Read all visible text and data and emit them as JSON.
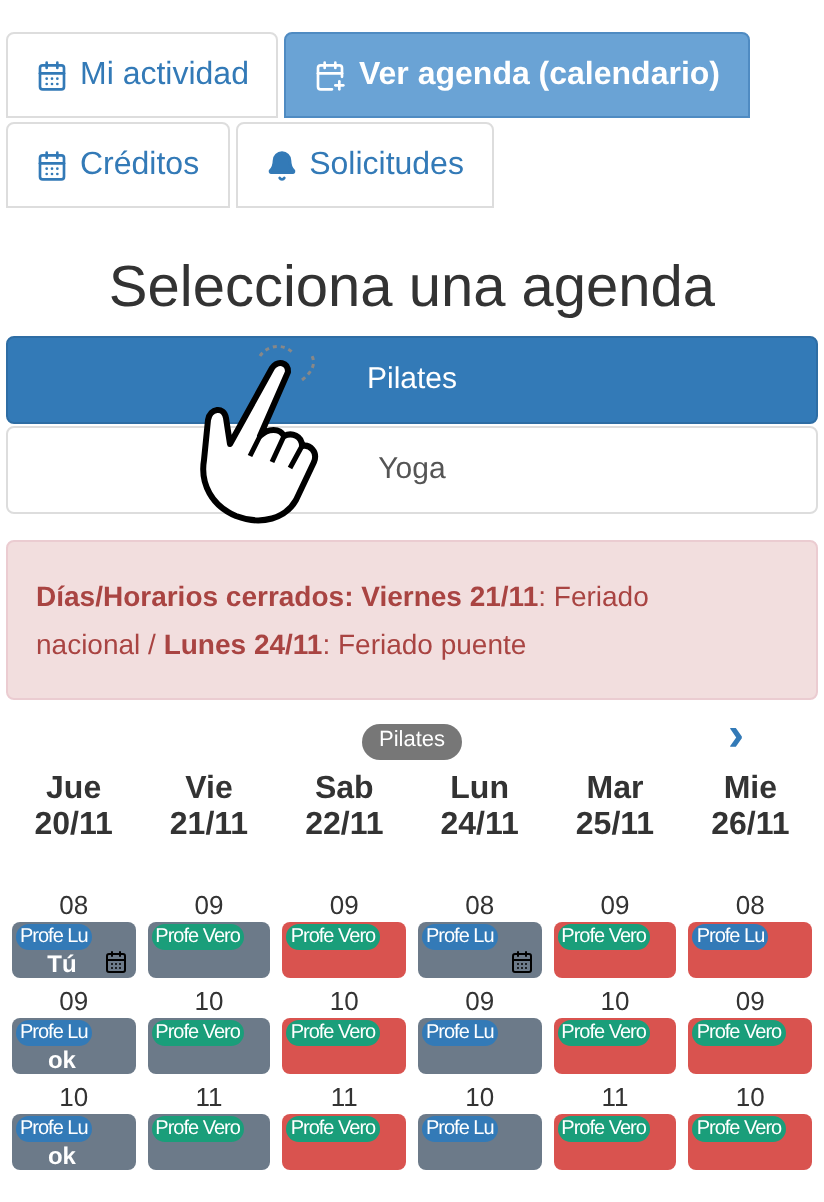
{
  "tabs": [
    {
      "label": "Mi actividad",
      "selected": false
    },
    {
      "label": "Ver agenda (calendario)",
      "selected": true
    },
    {
      "label": "Créditos",
      "selected": false
    },
    {
      "label": "Solicitudes",
      "selected": false
    }
  ],
  "title": "Selecciona una agenda",
  "agendas": [
    {
      "label": "Pilates",
      "selected": true
    },
    {
      "label": "Yoga",
      "selected": false
    }
  ],
  "alert": "**Días/Horarios cerrados:** **Viernes 21/11**: Feriado nacional / **Lunes 24/11**: Feriado puente",
  "calendar": {
    "badge": "Pilates",
    "next": "›",
    "days": [
      {
        "name": "Jue",
        "date": "20/11",
        "slots": [
          {
            "hour": "08",
            "teacher": {
              "label": "Profe Lu",
              "color": "#337ab7"
            },
            "color": "#6c7a89",
            "note": "Tú",
            "scheduled": true
          },
          {
            "hour": "09",
            "teacher": {
              "label": "Profe Lu",
              "color": "#337ab7"
            },
            "color": "#6c7a89",
            "note": "ok",
            "scheduled": false
          },
          {
            "hour": "10",
            "teacher": {
              "label": "Profe Lu",
              "color": "#337ab7"
            },
            "color": "#6c7a89",
            "note": "ok",
            "scheduled": false
          }
        ]
      },
      {
        "name": "Vie",
        "date": "21/11",
        "slots": [
          {
            "hour": "09",
            "teacher": {
              "label": "Profe Vero",
              "color": "#1a9e7a"
            },
            "color": "#6c7a89",
            "scheduled": false
          },
          {
            "hour": "10",
            "teacher": {
              "label": "Profe Vero",
              "color": "#1a9e7a"
            },
            "color": "#6c7a89",
            "scheduled": false
          },
          {
            "hour": "11",
            "teacher": {
              "label": "Profe Vero",
              "color": "#1a9e7a"
            },
            "color": "#6c7a89",
            "scheduled": false
          }
        ]
      },
      {
        "name": "Sab",
        "date": "22/11",
        "slots": [
          {
            "hour": "09",
            "teacher": {
              "label": "Profe Vero",
              "color": "#1a9e7a"
            },
            "color": "#d9534f",
            "scheduled": false
          },
          {
            "hour": "10",
            "teacher": {
              "label": "Profe Vero",
              "color": "#1a9e7a"
            },
            "color": "#d9534f",
            "scheduled": false
          },
          {
            "hour": "11",
            "teacher": {
              "label": "Profe Vero",
              "color": "#1a9e7a"
            },
            "color": "#d9534f",
            "scheduled": false
          }
        ]
      },
      {
        "name": "Lun",
        "date": "24/11",
        "slots": [
          {
            "hour": "08",
            "teacher": {
              "label": "Profe Lu",
              "color": "#337ab7"
            },
            "color": "#6c7a89",
            "scheduled": true
          },
          {
            "hour": "09",
            "teacher": {
              "label": "Profe Lu",
              "color": "#337ab7"
            },
            "color": "#6c7a89",
            "scheduled": false
          },
          {
            "hour": "10",
            "teacher": {
              "label": "Profe Lu",
              "color": "#337ab7"
            },
            "color": "#6c7a89",
            "scheduled": false
          }
        ]
      },
      {
        "name": "Mar",
        "date": "25/11",
        "slots": [
          {
            "hour": "09",
            "teacher": {
              "label": "Profe Vero",
              "color": "#1a9e7a"
            },
            "color": "#d9534f",
            "scheduled": false
          },
          {
            "hour": "10",
            "teacher": {
              "label": "Profe Vero",
              "color": "#1a9e7a"
            },
            "color": "#d9534f",
            "scheduled": false
          },
          {
            "hour": "11",
            "teacher": {
              "label": "Profe Vero",
              "color": "#1a9e7a"
            },
            "color": "#d9534f",
            "scheduled": false
          }
        ]
      },
      {
        "name": "Mie",
        "date": "26/11",
        "slots": [
          {
            "hour": "08",
            "teacher": {
              "label": "Profe Lu",
              "color": "#337ab7"
            },
            "color": "#d9534f",
            "scheduled": false
          },
          {
            "hour": "09",
            "teacher": {
              "label": "Profe Vero",
              "color": "#1a9e7a"
            },
            "color": "#d9534f",
            "scheduled": false
          },
          {
            "hour": "10",
            "teacher": {
              "label": "Profe Vero",
              "color": "#1a9e7a"
            },
            "color": "#d9534f",
            "scheduled": false
          }
        ]
      }
    ]
  }
}
